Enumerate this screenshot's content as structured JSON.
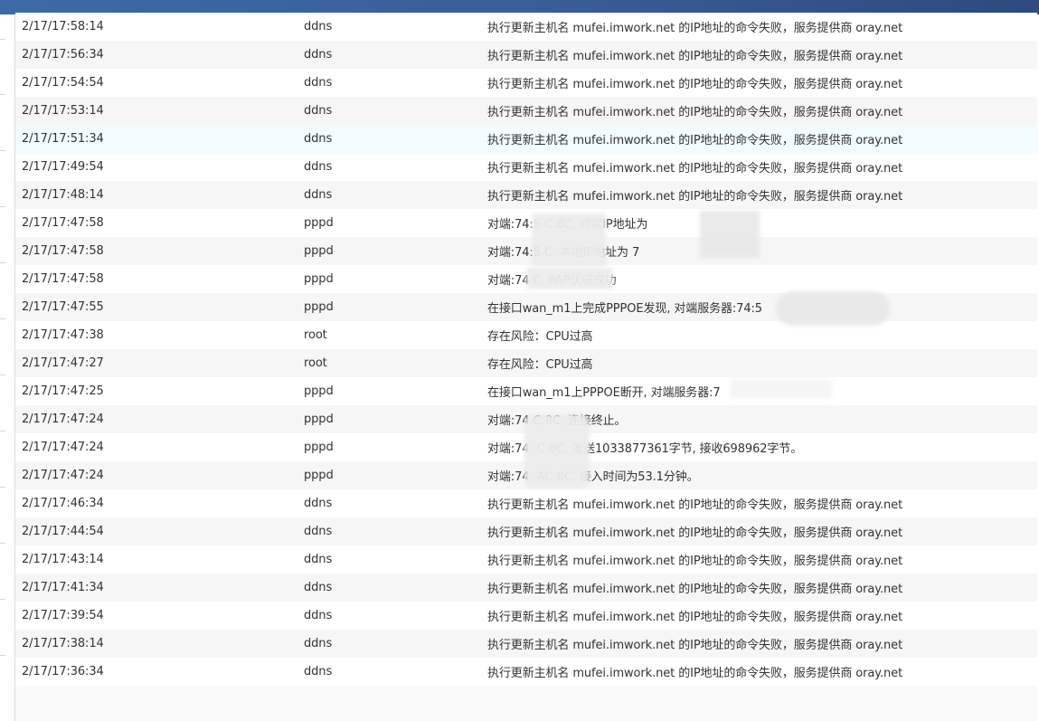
{
  "rows": [
    {
      "time": "2/17/17:58:14",
      "source": "ddns",
      "message": "执行更新主机名 mufei.imwork.net 的IP地址的命令失败，服务提供商 oray.net"
    },
    {
      "time": "2/17/17:56:34",
      "source": "ddns",
      "message": "执行更新主机名 mufei.imwork.net 的IP地址的命令失败，服务提供商 oray.net"
    },
    {
      "time": "2/17/17:54:54",
      "source": "ddns",
      "message": "执行更新主机名 mufei.imwork.net 的IP地址的命令失败，服务提供商 oray.net"
    },
    {
      "time": "2/17/17:53:14",
      "source": "ddns",
      "message": "执行更新主机名 mufei.imwork.net 的IP地址的命令失败，服务提供商 oray.net"
    },
    {
      "time": "2/17/17:51:34",
      "source": "ddns",
      "message": "执行更新主机名 mufei.imwork.net 的IP地址的命令失败，服务提供商 oray.net"
    },
    {
      "time": "2/17/17:49:54",
      "source": "ddns",
      "message": "执行更新主机名 mufei.imwork.net 的IP地址的命令失败，服务提供商 oray.net"
    },
    {
      "time": "2/17/17:48:14",
      "source": "ddns",
      "message": "执行更新主机名 mufei.imwork.net 的IP地址的命令失败，服务提供商 oray.net"
    },
    {
      "time": "2/17/17:47:58",
      "source": "pppd",
      "message": "对端:74:5         C:8C, 对端IP地址为"
    },
    {
      "time": "2/17/17:47:58",
      "source": "pppd",
      "message": "对端:74:5          C, 本地IP地址为 7"
    },
    {
      "time": "2/17/17:47:58",
      "source": "pppd",
      "message": "对端:74            C, PAP认证成功"
    },
    {
      "time": "2/17/17:47:55",
      "source": "pppd",
      "message": "在接口wan_m1上完成PPPOE发现, 对端服务器:74:5"
    },
    {
      "time": "2/17/17:47:38",
      "source": "root",
      "message": "存在风险：CPU过高"
    },
    {
      "time": "2/17/17:47:27",
      "source": "root",
      "message": "存在风险：CPU过高"
    },
    {
      "time": "2/17/17:47:25",
      "source": "pppd",
      "message": "在接口wan_m1上PPPOE断开, 对端服务器:7"
    },
    {
      "time": "2/17/17:47:24",
      "source": "pppd",
      "message": "对端:74          C:8C, 连接终止。"
    },
    {
      "time": "2/17/17:47:24",
      "source": "pppd",
      "message": "对端:74:          C:8C, 发送1033877361字节, 接收698962字节。"
    },
    {
      "time": "2/17/17:47:24",
      "source": "pppd",
      "message": "对端:74:          AC:8C, 接入时间为53.1分钟。"
    },
    {
      "time": "2/17/17:46:34",
      "source": "ddns",
      "message": "执行更新主机名 mufei.imwork.net 的IP地址的命令失败，服务提供商 oray.net"
    },
    {
      "time": "2/17/17:44:54",
      "source": "ddns",
      "message": "执行更新主机名 mufei.imwork.net 的IP地址的命令失败，服务提供商 oray.net"
    },
    {
      "time": "2/17/17:43:14",
      "source": "ddns",
      "message": "执行更新主机名 mufei.imwork.net 的IP地址的命令失败，服务提供商 oray.net"
    },
    {
      "time": "2/17/17:41:34",
      "source": "ddns",
      "message": "执行更新主机名 mufei.imwork.net 的IP地址的命令失败，服务提供商 oray.net"
    },
    {
      "time": "2/17/17:39:54",
      "source": "ddns",
      "message": "执行更新主机名 mufei.imwork.net 的IP地址的命令失败，服务提供商 oray.net"
    },
    {
      "time": "2/17/17:38:14",
      "source": "ddns",
      "message": "执行更新主机名 mufei.imwork.net 的IP地址的命令失败，服务提供商 oray.net"
    },
    {
      "time": "2/17/17:36:34",
      "source": "ddns",
      "message": "执行更新主机名 mufei.imwork.net 的IP地址的命令失败，服务提供商 oray.net"
    }
  ],
  "colors": {
    "header_bar": "#3a5e98",
    "row_alt": "#f6f6f6",
    "row_highlight": "#f2fbfd",
    "text": "#333333"
  }
}
